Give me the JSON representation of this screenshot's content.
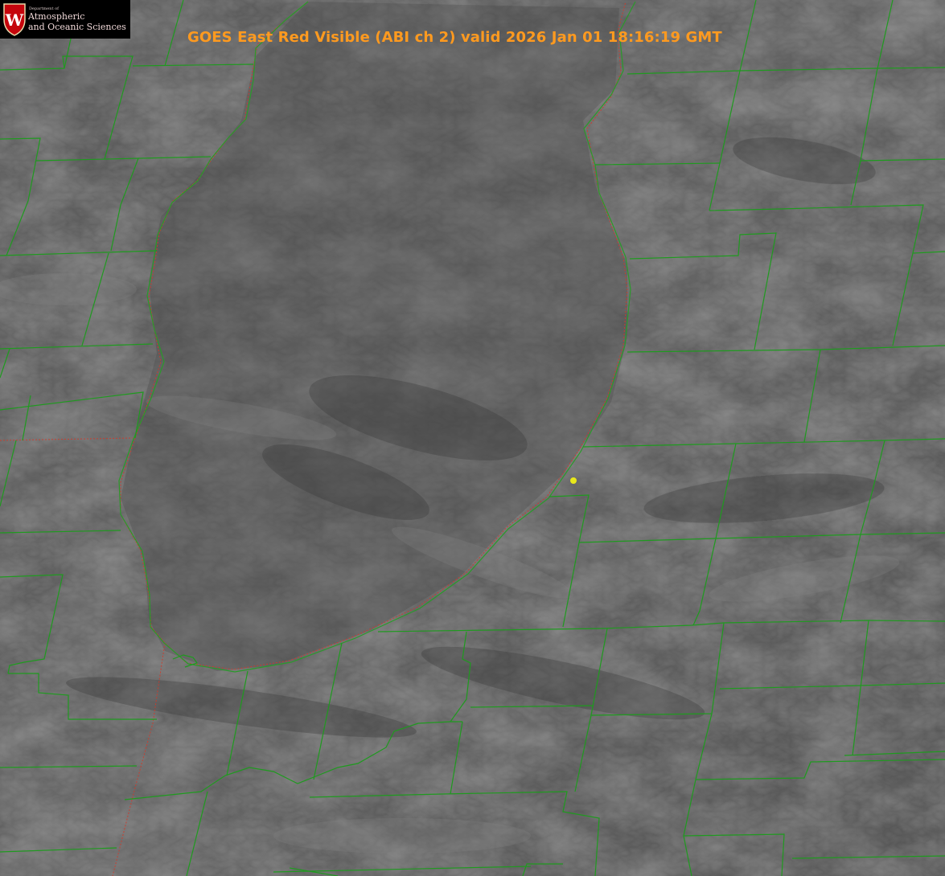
{
  "title": "GOES East Red Visible (ABI ch 2) valid 2026 Jan 01 18:16:19 GMT",
  "logo": {
    "department": "Department of",
    "line1": "Atmospheric",
    "line2": "and Oceanic Sciences",
    "crest_letter": "W"
  },
  "colors": {
    "title": "#ff9a1f",
    "county_lines": "#1f9a1f",
    "state_lines": "#d23a2a",
    "marker": "#e8e81a",
    "crest": "#c5050c"
  },
  "icons": {
    "logo": "uw-crest-icon",
    "marker": "station-dot-icon"
  }
}
